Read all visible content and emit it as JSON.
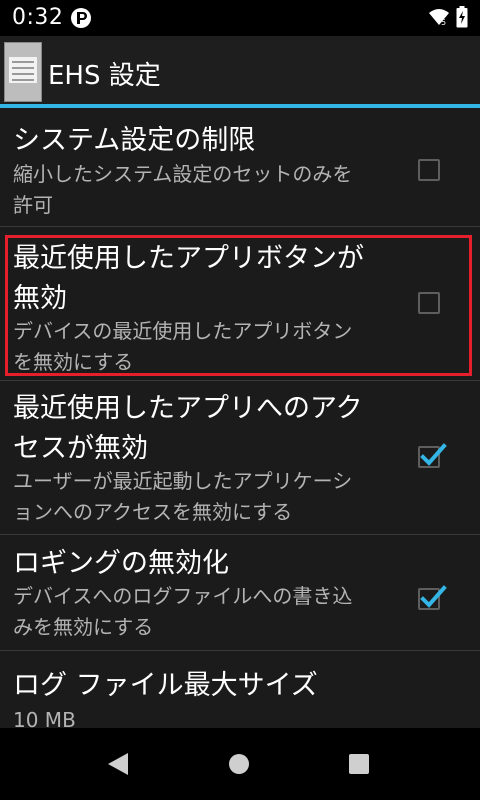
{
  "status_bar": {
    "time": "0:32",
    "notification_icon": "app-notification-icon",
    "wifi_icon": "wifi-icon",
    "battery_icon": "battery-charging-icon"
  },
  "action_bar": {
    "title": "EHS 設定",
    "logo_icon": "ehs-app-icon",
    "accent_color": "#33b5e5"
  },
  "preferences": [
    {
      "title": "システム設定の制限",
      "summary": "縮小したシステム設定のセットのみを\n許可",
      "checked": false
    },
    {
      "title": "最近使用したアプリボタンが\n無効",
      "summary": "デバイスの最近使用したアプリボタン\nを無効にする",
      "checked": false,
      "highlighted": true
    },
    {
      "title": "最近使用したアプリへのアク\nセスが無効",
      "summary": "ユーザーが最近起動したアプリケーシ\nョンへのアクセスを無効にする",
      "checked": true
    },
    {
      "title": "ロギングの無効化",
      "summary": "デバイスへのログファイルへの書き込\nみを無効にする",
      "checked": true
    },
    {
      "title": "ログ ファイル最大サイズ",
      "summary": "10 MB"
    }
  ],
  "colors": {
    "highlight": "#e5202c",
    "check": "#33b5e5"
  },
  "nav_bar": {
    "back_icon": "back-triangle-icon",
    "home_icon": "home-circle-icon",
    "recents_icon": "recents-square-icon"
  }
}
